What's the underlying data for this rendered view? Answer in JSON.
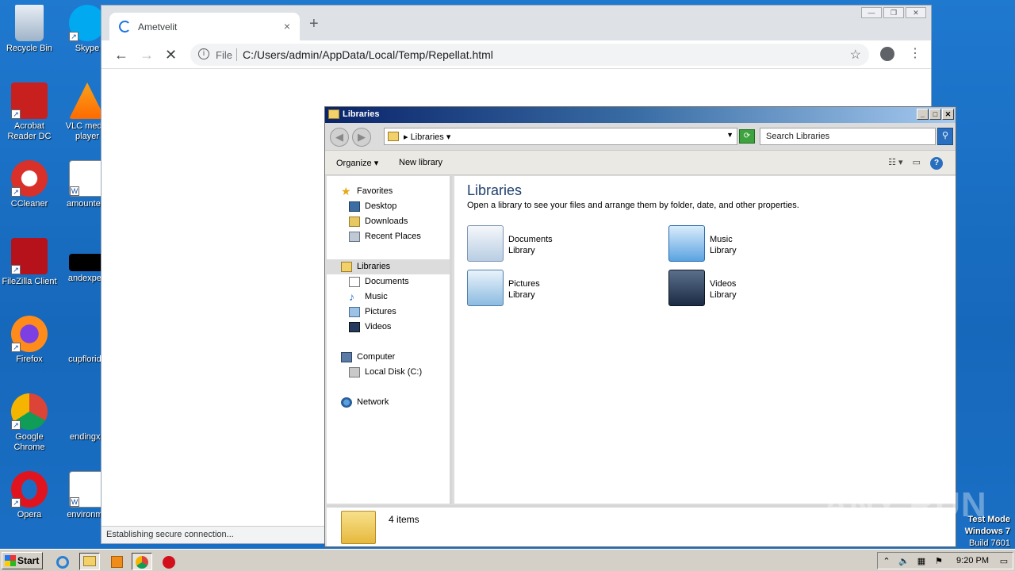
{
  "desktop": {
    "icons": [
      {
        "label": "Recycle Bin"
      },
      {
        "label": "Skype"
      },
      {
        "label": "Acrobat Reader DC"
      },
      {
        "label": "VLC media player"
      },
      {
        "label": "CCleaner"
      },
      {
        "label": "amountent"
      },
      {
        "label": "FileZilla Client"
      },
      {
        "label": "andexperi"
      },
      {
        "label": "Firefox"
      },
      {
        "label": "cupflorida"
      },
      {
        "label": "Google Chrome"
      },
      {
        "label": "endingxx"
      },
      {
        "label": "Opera"
      },
      {
        "label": "environme"
      }
    ]
  },
  "chrome": {
    "tab_title": "Ametvelit",
    "tab_close": "×",
    "new_tab": "+",
    "scheme_label": "File",
    "url": "C:/Users/admin/AppData/Local/Temp/Repellat.html",
    "status": "Establishing secure connection..."
  },
  "explorer": {
    "title": "Libraries",
    "breadcrumb": "Libraries",
    "search_placeholder": "Search Libraries",
    "toolbar": {
      "organize": "Organize",
      "new_library": "New library"
    },
    "nav": {
      "favorites": "Favorites",
      "desktop": "Desktop",
      "downloads": "Downloads",
      "recent_places": "Recent Places",
      "libraries": "Libraries",
      "documents": "Documents",
      "music": "Music",
      "pictures": "Pictures",
      "videos": "Videos",
      "computer": "Computer",
      "local_disk": "Local Disk (C:)",
      "network": "Network"
    },
    "heading": "Libraries",
    "subheading": "Open a library to see your files and arrange them by folder, date, and other properties.",
    "libraries": [
      {
        "name": "Documents",
        "kind": "Library"
      },
      {
        "name": "Music",
        "kind": "Library"
      },
      {
        "name": "Pictures",
        "kind": "Library"
      },
      {
        "name": "Videos",
        "kind": "Library"
      }
    ],
    "item_count": "4 items"
  },
  "watermark": "ANY RUN",
  "test_mode": {
    "line1": "Test Mode",
    "line2": "Windows 7",
    "line3": "Build 7601"
  },
  "taskbar": {
    "start": "Start",
    "clock": "9:20 PM"
  }
}
